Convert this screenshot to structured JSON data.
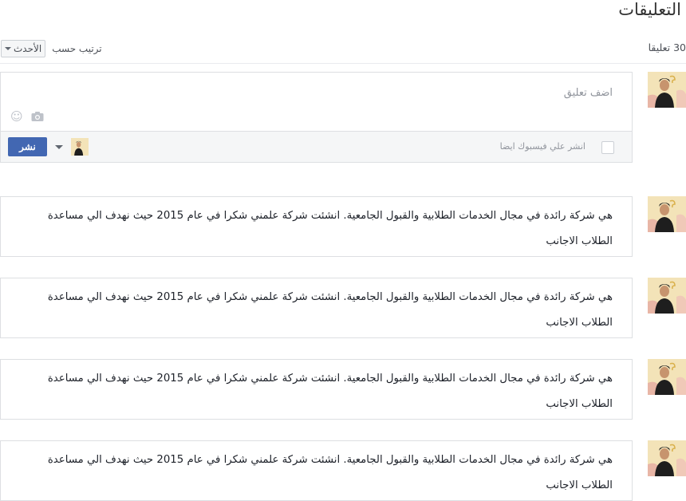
{
  "header": {
    "title": "التعليقات"
  },
  "toolbar": {
    "count_label": "30 تعليقا",
    "sort_label": "ترتيب حسب",
    "sort_value": "الأحدث"
  },
  "composer": {
    "placeholder": "اضف تعليق",
    "also_post_label": "انشر علي فيسبوك ايضا",
    "post_button": "نشر",
    "icons": [
      "emoji-icon",
      "camera-icon",
      "dropdown-caret-icon"
    ]
  },
  "comments": [
    {
      "text": "هي شركة رائدة في مجال الخدمات الطلابية والقبول الجامعية. انشئت شركة علمني شكرا في عام 2015 حيث نهدف الي مساعدة الطلاب الاجانب"
    },
    {
      "text": "هي شركة رائدة في مجال الخدمات الطلابية والقبول الجامعية. انشئت شركة علمني شكرا في عام 2015 حيث نهدف الي مساعدة الطلاب الاجانب"
    },
    {
      "text": "هي شركة رائدة في مجال الخدمات الطلابية والقبول الجامعية. انشئت شركة علمني شكرا في عام 2015 حيث نهدف الي مساعدة الطلاب الاجانب"
    },
    {
      "text": "هي شركة رائدة في مجال الخدمات الطلابية والقبول الجامعية. انشئت شركة علمني شكرا في عام 2015 حيث نهدف الي مساعدة الطلاب الاجانب"
    }
  ],
  "colors": {
    "primary": "#4267b2",
    "border": "#dddfe2",
    "muted": "#90949c",
    "footer_bg": "#f5f6f7"
  }
}
